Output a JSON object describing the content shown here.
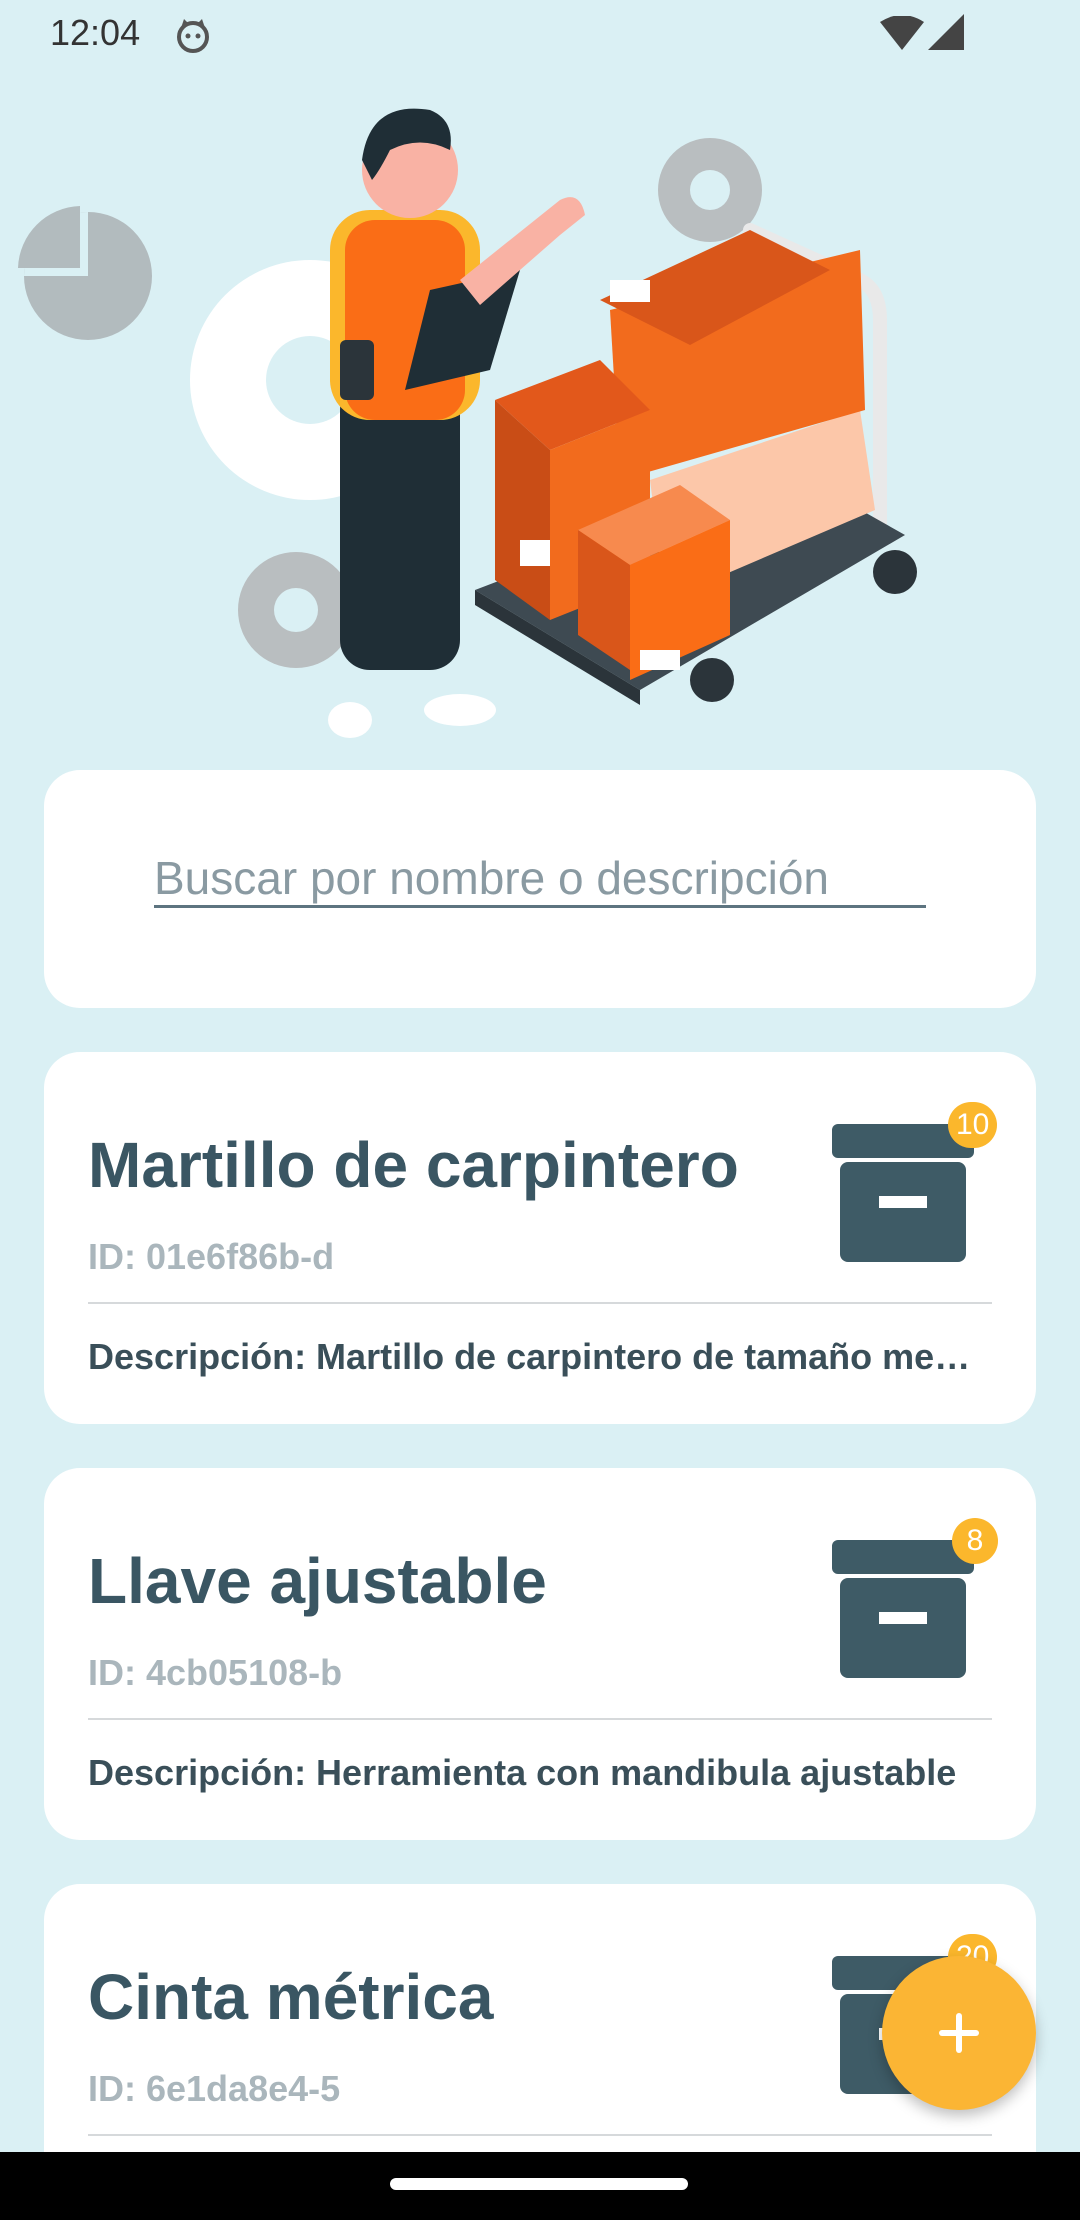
{
  "status_bar": {
    "time": "12:04",
    "icons": [
      "cat-face-icon",
      "wifi-icon",
      "signal-icon"
    ]
  },
  "hero": {
    "illustration": "warehouse-worker-with-boxes-illustration"
  },
  "search": {
    "placeholder": "Buscar por nombre o descripción",
    "value": ""
  },
  "items": [
    {
      "name": "Martillo de carpintero",
      "id": "ID: 01e6f86b-d",
      "description": "Descripción: Martillo de carpintero de tamaño me…",
      "count": "10",
      "icon": "archive-box-icon"
    },
    {
      "name": "Llave ajustable",
      "id": "ID: 4cb05108-b",
      "description": "Descripción: Herramienta con mandibula ajustable",
      "count": "8",
      "icon": "archive-box-icon"
    },
    {
      "name": "Cinta métrica",
      "id": "ID: 6e1da8e4-5",
      "description": "",
      "count": "20",
      "icon": "archive-box-icon"
    }
  ],
  "fab": {
    "icon": "plus-icon"
  },
  "colors": {
    "background": "#daf0f4",
    "card": "#ffffff",
    "title_text": "#3a5663",
    "id_text": "#aab6bc",
    "accent": "#fbb72c",
    "box_icon": "#3e5b66",
    "illustration_orange": "#f26b1d"
  }
}
